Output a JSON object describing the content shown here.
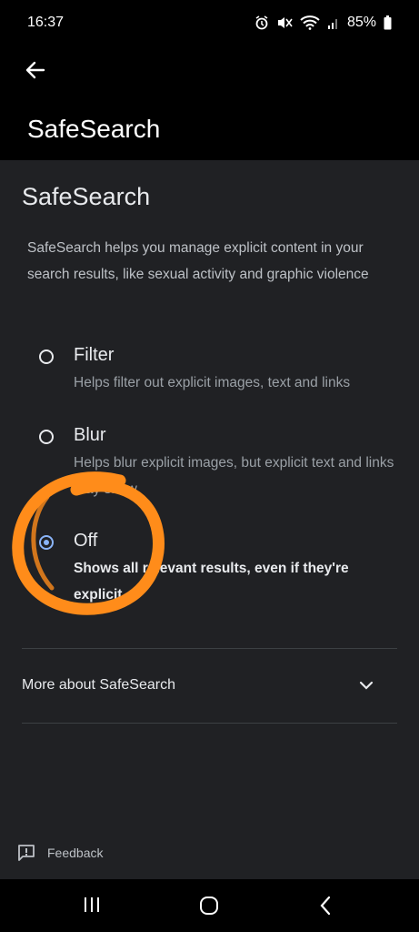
{
  "status_bar": {
    "time": "16:37",
    "battery": "85%"
  },
  "app_bar": {
    "title": "SafeSearch"
  },
  "main": {
    "title": "SafeSearch",
    "description": "SafeSearch helps you manage explicit content in your search results, like sexual activity and graphic violence",
    "options": [
      {
        "label": "Filter",
        "description": "Helps filter out explicit images, text and links",
        "selected": false
      },
      {
        "label": "Blur",
        "description": "Helps blur explicit images, but explicit text and links may show",
        "selected": false
      },
      {
        "label": "Off",
        "description": "Shows all relevant results, even if they're explicit",
        "selected": true
      }
    ],
    "more_label": "More about SafeSearch",
    "feedback_label": "Feedback"
  },
  "colors": {
    "accent": "#8ab4f8",
    "annotation": "#ff8c1a",
    "background": "#202124"
  },
  "icons": {
    "back": "arrow-left-icon",
    "alarm": "alarm-icon",
    "mute": "mute-icon",
    "wifi": "wifi-icon",
    "signal": "signal-icon",
    "battery": "battery-icon",
    "chevron": "chevron-down-icon",
    "feedback": "feedback-icon",
    "recents": "recents-icon",
    "home": "home-icon",
    "back_nav": "back-nav-icon"
  }
}
